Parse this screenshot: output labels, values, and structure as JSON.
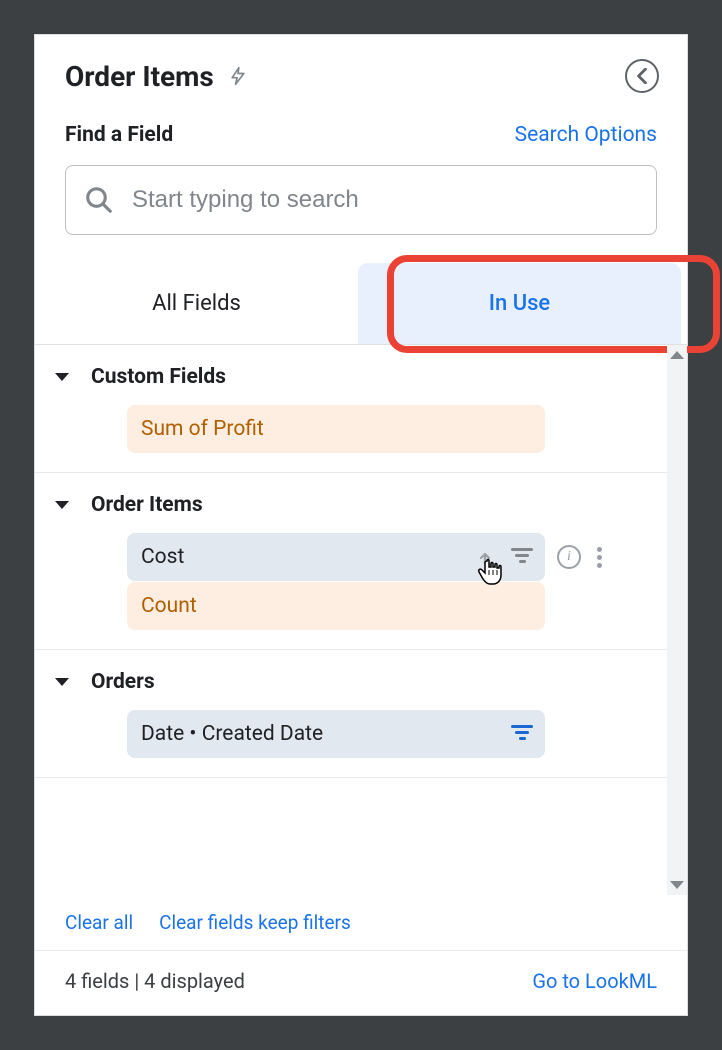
{
  "header": {
    "title": "Order Items"
  },
  "search": {
    "find_label": "Find a Field",
    "options_label": "Search Options",
    "placeholder": "Start typing to search"
  },
  "tabs": {
    "all_fields": "All Fields",
    "in_use": "In Use"
  },
  "groups": {
    "custom_fields": {
      "title": "Custom Fields",
      "items": [
        {
          "label": "Sum of Profit"
        }
      ]
    },
    "order_items": {
      "title": "Order Items",
      "items": [
        {
          "label": "Cost"
        },
        {
          "label": "Count"
        }
      ]
    },
    "orders": {
      "title": "Orders",
      "items": [
        {
          "label": "Date • Created Date"
        }
      ]
    }
  },
  "actions": {
    "clear_all": "Clear all",
    "clear_keep_filters": "Clear fields keep filters"
  },
  "footer": {
    "status": "4 fields | 4 displayed",
    "go_lookml": "Go to LookML"
  }
}
